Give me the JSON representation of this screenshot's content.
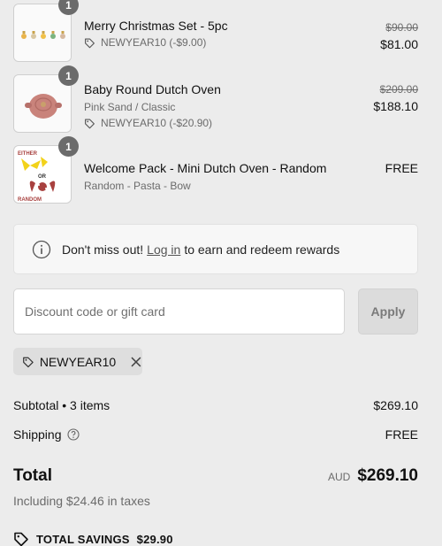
{
  "items": [
    {
      "title": "Merry Christmas Set - 5pc",
      "variant": "",
      "discount": "NEWYEAR10 (-$9.00)",
      "price_old": "$90.00",
      "price": "$81.00",
      "quantity": "1",
      "thumb_icon": "ornament-set-image"
    },
    {
      "title": "Baby Round Dutch Oven",
      "variant": "Pink Sand / Classic",
      "discount": "NEWYEAR10 (-$20.90)",
      "price_old": "$209.00",
      "price": "$188.10",
      "quantity": "1",
      "thumb_icon": "dutch-oven-image"
    },
    {
      "title": "Welcome Pack - Mini Dutch Oven - Random",
      "variant": "Random - Pasta - Bow",
      "discount": "",
      "price_old": "",
      "price": "FREE",
      "quantity": "1",
      "thumb_icon": "pasta-bow-image",
      "thumb_text_top": "EITHER",
      "thumb_text_mid": "OR",
      "thumb_text_bottom": "RANDOM"
    }
  ],
  "notice": {
    "before": "Don't miss out!",
    "link": "Log in",
    "after": "to earn and redeem rewards"
  },
  "discount_form": {
    "placeholder": "Discount code or gift card",
    "apply_label": "Apply"
  },
  "applied_code": "NEWYEAR10",
  "summary": {
    "subtotal_label": "Subtotal • 3 items",
    "subtotal_value": "$269.10",
    "shipping_label": "Shipping",
    "shipping_value": "FREE",
    "total_label": "Total",
    "currency": "AUD",
    "total_value": "$269.10",
    "tax_note": "Including $24.46 in taxes",
    "savings_label": "TOTAL SAVINGS",
    "savings_value": "$29.90"
  },
  "colors": {
    "background": "#ececec",
    "badge": "#6b6b6b",
    "muted_text": "#6b6b6b",
    "oven_pink": "#c9837b",
    "bow_red": "#a8413f",
    "pasta_yellow": "#f2d21a"
  }
}
